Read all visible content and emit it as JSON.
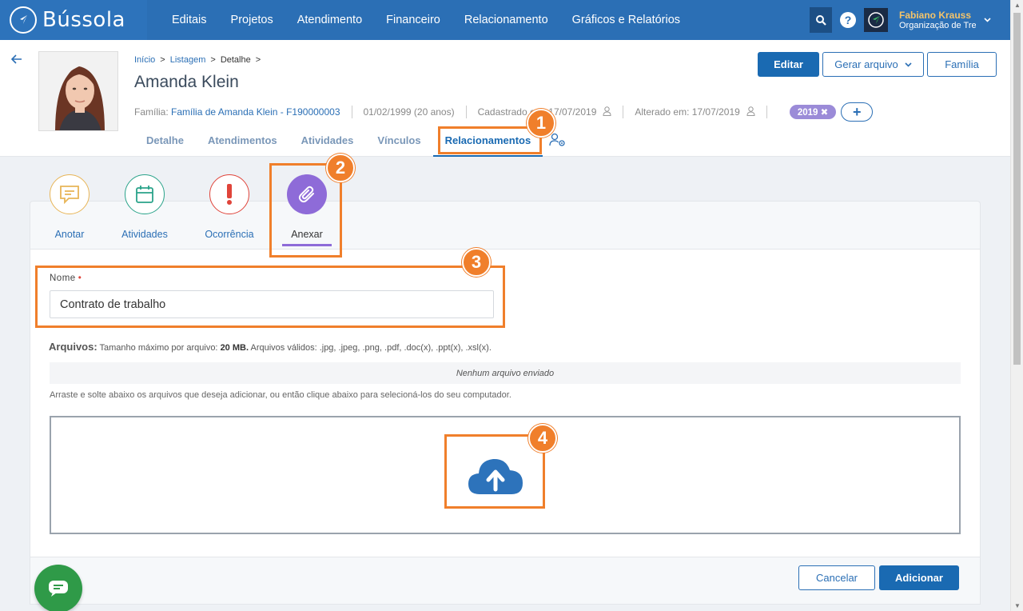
{
  "app": {
    "logo_text": "Bússola",
    "nav": [
      "Editais",
      "Projetos",
      "Atendimento",
      "Financeiro",
      "Relacionamento",
      "Gráficos e Relatórios"
    ],
    "user_name": "Fabiano Krauss",
    "user_org": "Organização de Tre",
    "help_symbol": "?"
  },
  "breadcrumb": {
    "items": [
      "Início",
      "Listagem",
      "Detalhe"
    ],
    "separator": ">"
  },
  "person": {
    "name": "Amanda Klein",
    "family_label": "Família:",
    "family_value": "Família de Amanda Klein - F190000003",
    "birth": "01/02/1999 (20 anos)",
    "created": "Cadastrado em: 17/07/2019",
    "updated": "Alterado em: 17/07/2019",
    "tag": "2019 ✖",
    "add_symbol": "+"
  },
  "header_actions": {
    "edit": "Editar",
    "generate": "Gerar arquivo",
    "family": "Família"
  },
  "tabs": [
    "Detalhe",
    "Atendimentos",
    "Atividades",
    "Vínculos",
    "Relacionamentos"
  ],
  "actions": {
    "anotar": "Anotar",
    "atividades": "Atividades",
    "ocorrencia": "Ocorrência",
    "anexar": "Anexar",
    "colors": {
      "anotar": "#e8b557",
      "atividades": "#2aa38a",
      "ocorrencia": "#e0443a",
      "anexar": "#8e6bd8"
    }
  },
  "form": {
    "name_label": "Nome",
    "required_mark": "•",
    "name_value": "Contrato de trabalho",
    "files_label": "Arquivos:",
    "files_hint_pre": "Tamanho máximo por arquivo:",
    "files_max": "20 MB.",
    "files_hint_post": "Arquivos válidos: .jpg, .jpeg, .png, .pdf, .doc(x), .ppt(x), .xsl(x).",
    "no_files": "Nenhum arquivo enviado",
    "drag_hint": "Arraste e solte abaixo os arquivos que deseja adicionar, ou então clique abaixo para selecioná-los do seu computador."
  },
  "footer": {
    "cancel": "Cancelar",
    "add": "Adicionar"
  },
  "annotations": [
    "1",
    "2",
    "3",
    "4"
  ],
  "colors": {
    "nav_bg": "#2b6fb5",
    "primary": "#1a6ab2",
    "annotation": "#f07f2b",
    "chat": "#2f9a48"
  }
}
